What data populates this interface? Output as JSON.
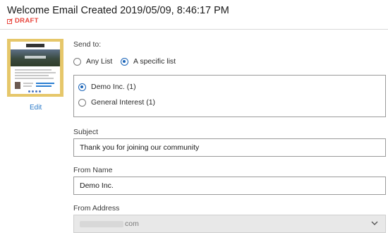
{
  "header": {
    "title": "Welcome Email Created 2019/05/09, 8:46:17 PM",
    "status": "DRAFT"
  },
  "thumbnail": {
    "edit_label": "Edit"
  },
  "send_to": {
    "label": "Send to:",
    "options": [
      {
        "label": "Any List",
        "selected": false
      },
      {
        "label": "A specific list",
        "selected": true
      }
    ],
    "lists": [
      {
        "label": "Demo Inc. (1)",
        "selected": true
      },
      {
        "label": "General Interest (1)",
        "selected": false
      }
    ]
  },
  "subject": {
    "label": "Subject",
    "value": "Thank you for joining our community"
  },
  "from_name": {
    "label": "From Name",
    "value": "Demo Inc."
  },
  "from_address": {
    "label": "From Address",
    "value_suffix": "com"
  },
  "colors": {
    "accent": "#1a64b8",
    "draft": "#e8453c",
    "link": "#2878c8",
    "thumb_frame": "#e6c76a"
  }
}
